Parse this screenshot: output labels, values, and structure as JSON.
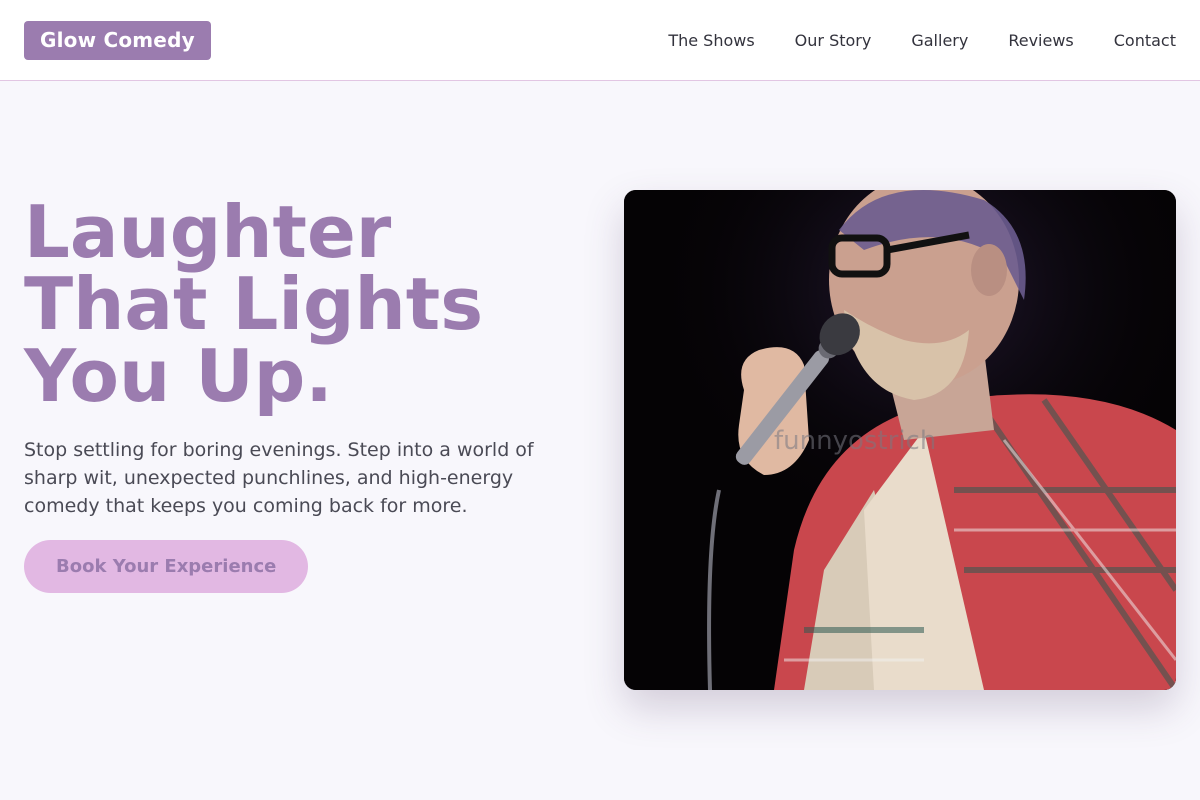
{
  "brand": {
    "name": "Glow Comedy"
  },
  "nav": {
    "items": [
      {
        "label": "The Shows"
      },
      {
        "label": "Our Story"
      },
      {
        "label": "Gallery"
      },
      {
        "label": "Reviews"
      },
      {
        "label": "Contact"
      }
    ]
  },
  "hero": {
    "title": "Laughter That Lights You Up.",
    "description": "Stop settling for boring evenings. Step into a world of sharp wit, unexpected punchlines, and high-energy comedy that keeps you coming back for more.",
    "cta_label": "Book Your Experience",
    "image": {
      "subject": "comedian-with-microphone",
      "watermark": "funnyostrich"
    }
  },
  "colors": {
    "brand": "#9b7caf",
    "cta_background": "#e2b8e3",
    "page_background": "#f8f7fc",
    "nav_border": "#e2c6e3"
  }
}
